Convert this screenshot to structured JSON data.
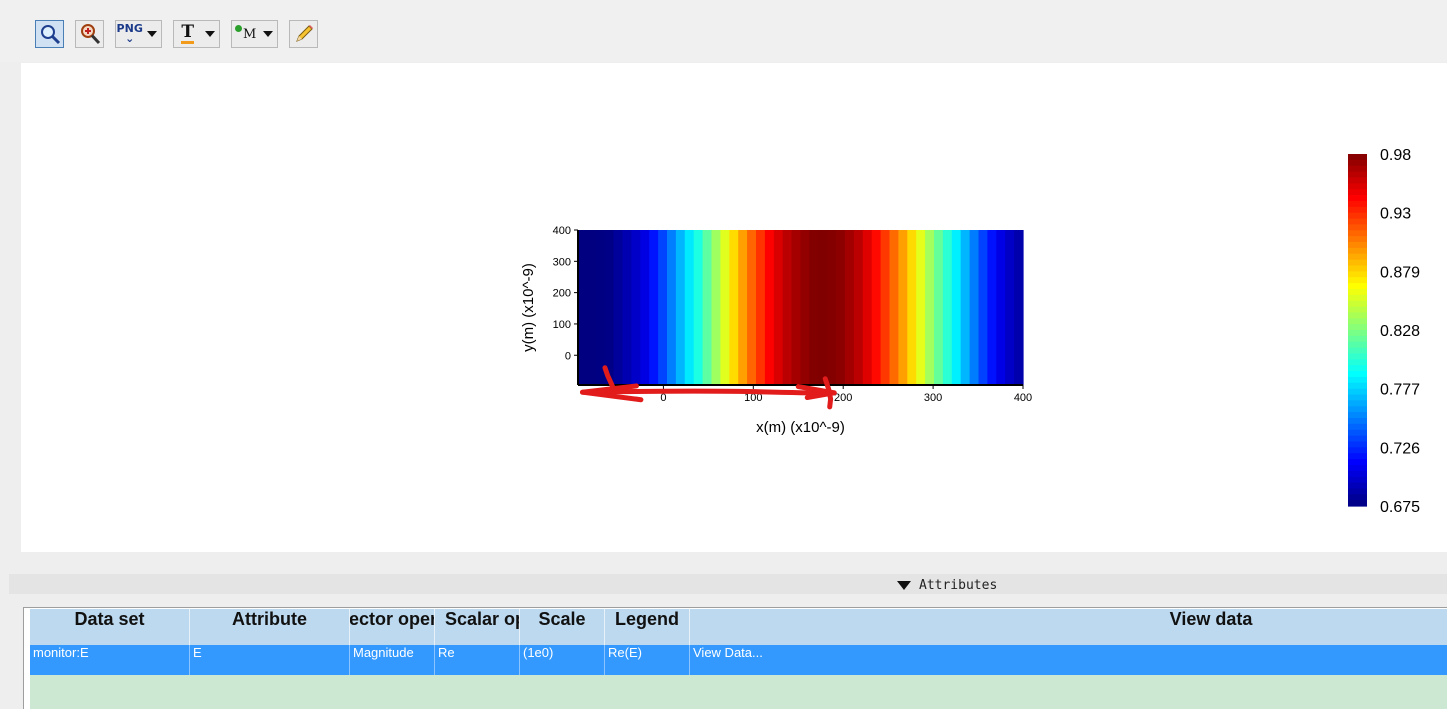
{
  "toolbar": {
    "buttons": [
      {
        "name": "zoom",
        "icon": "magnifier-icon",
        "active": true
      },
      {
        "name": "zoom-options",
        "icon": "magnifier-cross-icon"
      },
      {
        "name": "export-png",
        "icon": "png-icon",
        "label": "PNG"
      },
      {
        "name": "text",
        "icon": "text-t-icon",
        "label": "T"
      },
      {
        "name": "marker",
        "icon": "marker-m-icon",
        "label": "M"
      },
      {
        "name": "edit",
        "icon": "pencil-icon"
      }
    ]
  },
  "chart_data": {
    "type": "heatmap",
    "xlabel": "x(m) (x10^-9)",
    "ylabel": "y(m) (x10^-9)",
    "x_ticks": [
      "0",
      "100",
      "200",
      "300",
      "400"
    ],
    "y_ticks": [
      "0",
      "100",
      "200",
      "300",
      "400"
    ],
    "xlim": [
      -95,
      400
    ],
    "ylim": [
      -95,
      400
    ],
    "colormap": "jet",
    "colorbar_ticks": [
      "0.98",
      "0.93",
      "0.879",
      "0.828",
      "0.777",
      "0.726",
      "0.675"
    ],
    "colorbar_range": [
      0.675,
      0.98
    ],
    "profile_x": [
      -95,
      -80,
      -60,
      -40,
      -20,
      0,
      20,
      40,
      60,
      80,
      100,
      120,
      140,
      160,
      170,
      180,
      190,
      200,
      220,
      240,
      260,
      280,
      300,
      320,
      340,
      360,
      380,
      400
    ],
    "profile_value": [
      0.675,
      0.675,
      0.677,
      0.69,
      0.705,
      0.735,
      0.77,
      0.8,
      0.84,
      0.88,
      0.915,
      0.945,
      0.965,
      0.976,
      0.98,
      0.98,
      0.978,
      0.975,
      0.96,
      0.935,
      0.905,
      0.87,
      0.83,
      0.795,
      0.76,
      0.725,
      0.7,
      0.685
    ],
    "annotation": "red hand-drawn double arrow spanning x ≈ -90 to 190"
  },
  "attributes": {
    "toggle_label": "Attributes",
    "columns": [
      "Data set",
      "Attribute",
      "Vector operation",
      "Scalar operation",
      "Scale",
      "Legend",
      "View data"
    ],
    "rows": [
      [
        "monitor:E",
        "E",
        "Magnitude",
        "Re",
        "(1e0)",
        "Re(E)",
        "View Data..."
      ]
    ]
  }
}
